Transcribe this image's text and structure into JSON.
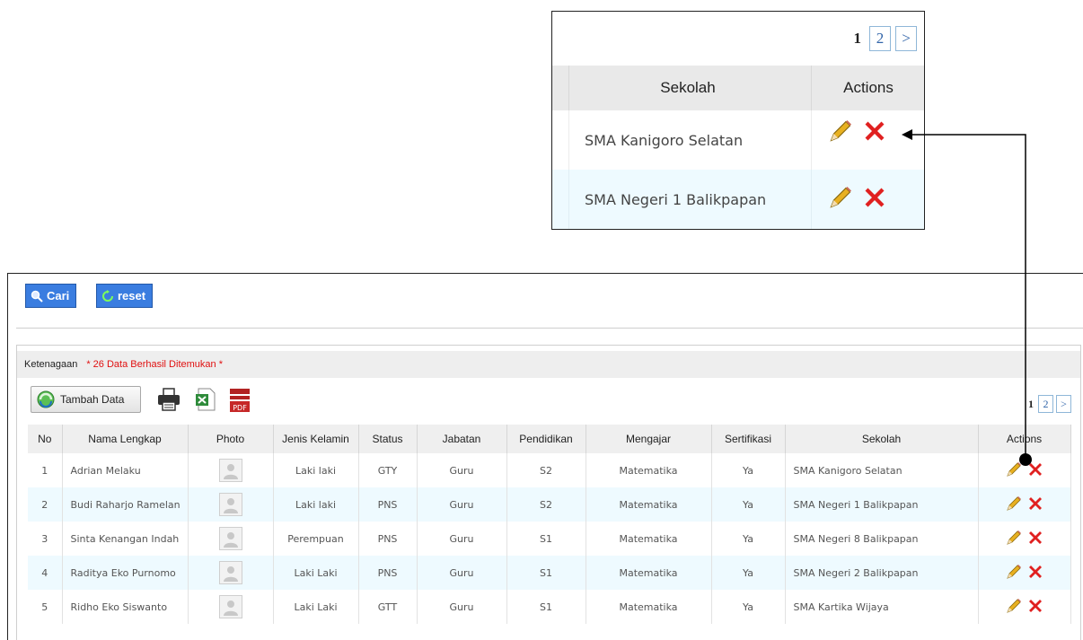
{
  "zoom": {
    "pager": {
      "current": "1",
      "next_page": "2",
      "next_label": ">"
    },
    "header": {
      "sekolah": "Sekolah",
      "actions": "Actions"
    },
    "rows": [
      {
        "sekolah": "SMA Kanigoro Selatan"
      },
      {
        "sekolah": "SMA Negeri 1 Balikpapan"
      }
    ]
  },
  "search": {
    "cari_label": "Cari",
    "reset_label": "reset"
  },
  "panel": {
    "title": "Ketenagaan",
    "result_text": "* 26 Data Berhasil Ditemukan *",
    "add_label": "Tambah Data",
    "tools": [
      "print-icon",
      "excel-icon",
      "pdf-icon"
    ],
    "pdf_text": "PDF",
    "pager": {
      "current": "1",
      "next_page": "2",
      "next_label": ">"
    }
  },
  "table": {
    "columns": [
      "No",
      "Nama Lengkap",
      "Photo",
      "Jenis Kelamin",
      "Status",
      "Jabatan",
      "Pendidikan",
      "Mengajar",
      "Sertifikasi",
      "Sekolah",
      "Actions"
    ],
    "rows": [
      {
        "no": "1",
        "nama": "Adrian Melaku",
        "jk": "Laki laki",
        "status": "GTY",
        "jabatan": "Guru",
        "pendidikan": "S2",
        "mengajar": "Matematika",
        "sertifikasi": "Ya",
        "sekolah": "SMA Kanigoro Selatan"
      },
      {
        "no": "2",
        "nama": "Budi Raharjo Ramelan",
        "jk": "Laki laki",
        "status": "PNS",
        "jabatan": "Guru",
        "pendidikan": "S2",
        "mengajar": "Matematika",
        "sertifikasi": "Ya",
        "sekolah": "SMA Negeri 1 Balikpapan"
      },
      {
        "no": "3",
        "nama": "Sinta Kenangan Indah",
        "jk": "Perempuan",
        "status": "PNS",
        "jabatan": "Guru",
        "pendidikan": "S1",
        "mengajar": "Matematika",
        "sertifikasi": "Ya",
        "sekolah": "SMA Negeri 8 Balikpapan"
      },
      {
        "no": "4",
        "nama": "Raditya Eko Purnomo",
        "jk": "Laki Laki",
        "status": "PNS",
        "jabatan": "Guru",
        "pendidikan": "S1",
        "mengajar": "Matematika",
        "sertifikasi": "Ya",
        "sekolah": "SMA Negeri 2 Balikpapan"
      },
      {
        "no": "5",
        "nama": "Ridho Eko Siswanto",
        "jk": "Laki Laki",
        "status": "GTT",
        "jabatan": "Guru",
        "pendidikan": "S1",
        "mengajar": "Matematika",
        "sertifikasi": "Ya",
        "sekolah": "SMA Kartika Wijaya"
      }
    ]
  },
  "colors": {
    "button_blue": "#3a7de0",
    "result_red": "#e01010",
    "delete_red": "#e02020",
    "edit_yellow": "#e8b020",
    "alt_row": "#eefaff"
  }
}
